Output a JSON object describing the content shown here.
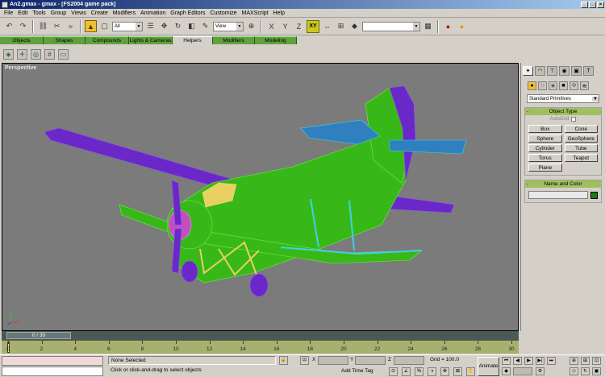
{
  "window": {
    "title": "An2.gmax - gmax - [FS2004 game pack]",
    "min": "_",
    "max": "□",
    "close": "×"
  },
  "menu": [
    "File",
    "Edit",
    "Tools",
    "Group",
    "Views",
    "Create",
    "Modifiers",
    "Animation",
    "Graph Editors",
    "Customize",
    "MAXScript",
    "Help"
  ],
  "toolbar": {
    "selection_filter": "All",
    "ref_coord": "View",
    "axis_constraint": "XY",
    "named_selection": ""
  },
  "tabs": [
    {
      "label": "Objects",
      "w": 54
    },
    {
      "label": "Shapes",
      "w": 52
    },
    {
      "label": "Compounds",
      "w": 54
    },
    {
      "label": "Lights & Cameras",
      "w": 54
    },
    {
      "label": "Helpers",
      "w": 50
    },
    {
      "label": "Modifiers",
      "w": 52
    },
    {
      "label": "Modeling",
      "w": 52
    }
  ],
  "active_tab": "Helpers",
  "viewport": {
    "label": "Perspective"
  },
  "panel": {
    "category": "Standard Primitives",
    "object_type_title": "Object Type",
    "autogrid": "AutoGrid",
    "objects": [
      "Box",
      "Cone",
      "Sphere",
      "GeoSphere",
      "Cylinder",
      "Tube",
      "Torus",
      "Teapot",
      "Plane"
    ],
    "name_color_title": "Name and Color",
    "object_color": "#108010"
  },
  "timeslider": {
    "label": "0 / 30"
  },
  "trackbar": {
    "ticks": [
      "0",
      "2",
      "4",
      "6",
      "8",
      "10",
      "12",
      "14",
      "16",
      "18",
      "20",
      "22",
      "24",
      "26",
      "28",
      "30"
    ]
  },
  "status": {
    "selection": "None Selected",
    "prompt": "Click or click-and-drag to select objects",
    "x_label": "X",
    "y_label": "Y",
    "z_label": "Z",
    "grid": "Grid = 100.0",
    "add_time_tag": "Add Time Tag",
    "animate": "Animate"
  }
}
